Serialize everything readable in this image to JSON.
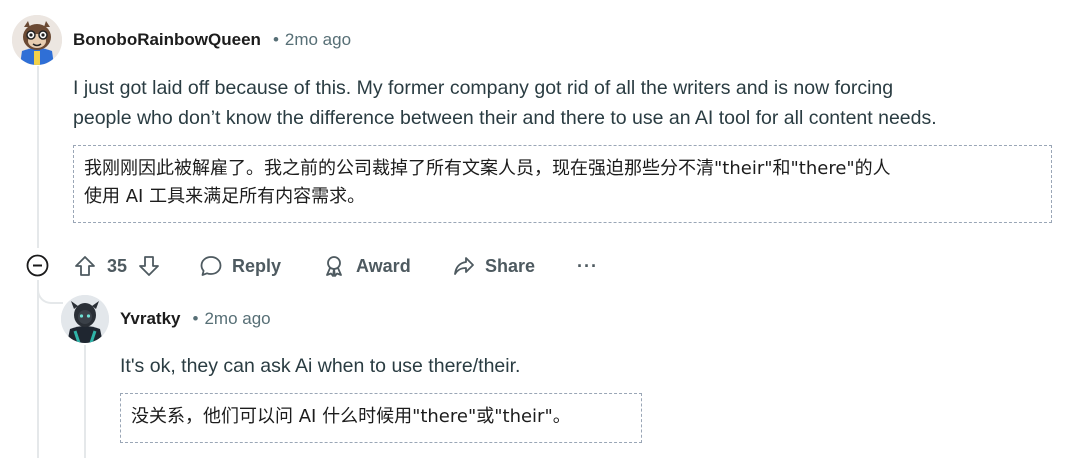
{
  "comment": {
    "username": "BonoboRainbowQueen",
    "timestamp": "2mo ago",
    "body": "I just got laid off because of this. My former company got rid of all the writers and is now forcing people who don’t know the difference between their and there to use an AI tool for all content needs.",
    "body_line1": "I just got laid off because of this. My former company got rid of all the writers and is now forcing",
    "body_line2": "people who don’t know the difference between their and there to use an AI tool for all content needs.",
    "translation_line1": "我刚刚因此被解雇了。我之前的公司裁掉了所有文案人员，现在强迫那些分不清\"their\"和\"there\"的人",
    "translation_line2": "使用 AI 工具来满足所有内容需求。",
    "votes": "35",
    "actions": {
      "reply": "Reply",
      "award": "Award",
      "share": "Share",
      "more": "···"
    }
  },
  "reply": {
    "username": "Yvratky",
    "timestamp": "2mo ago",
    "body": "It's ok, they can ask Ai when to use there/their.",
    "translation": "没关系，他们可以问 AI 什么时候用\"there\"或\"their\"。"
  },
  "icons": {
    "collapse": "minus-circle-icon",
    "upvote": "arrow-up-icon",
    "downvote": "arrow-down-icon",
    "reply": "speech-bubble-icon",
    "award": "award-icon",
    "share": "share-arrow-icon",
    "more": "ellipsis-icon"
  },
  "colors": {
    "text": "#1c1c1c",
    "meta": "#576f76",
    "action": "#4e5a60",
    "thread_line": "#e5e8ea",
    "translation_border": "#9aa6b6"
  }
}
